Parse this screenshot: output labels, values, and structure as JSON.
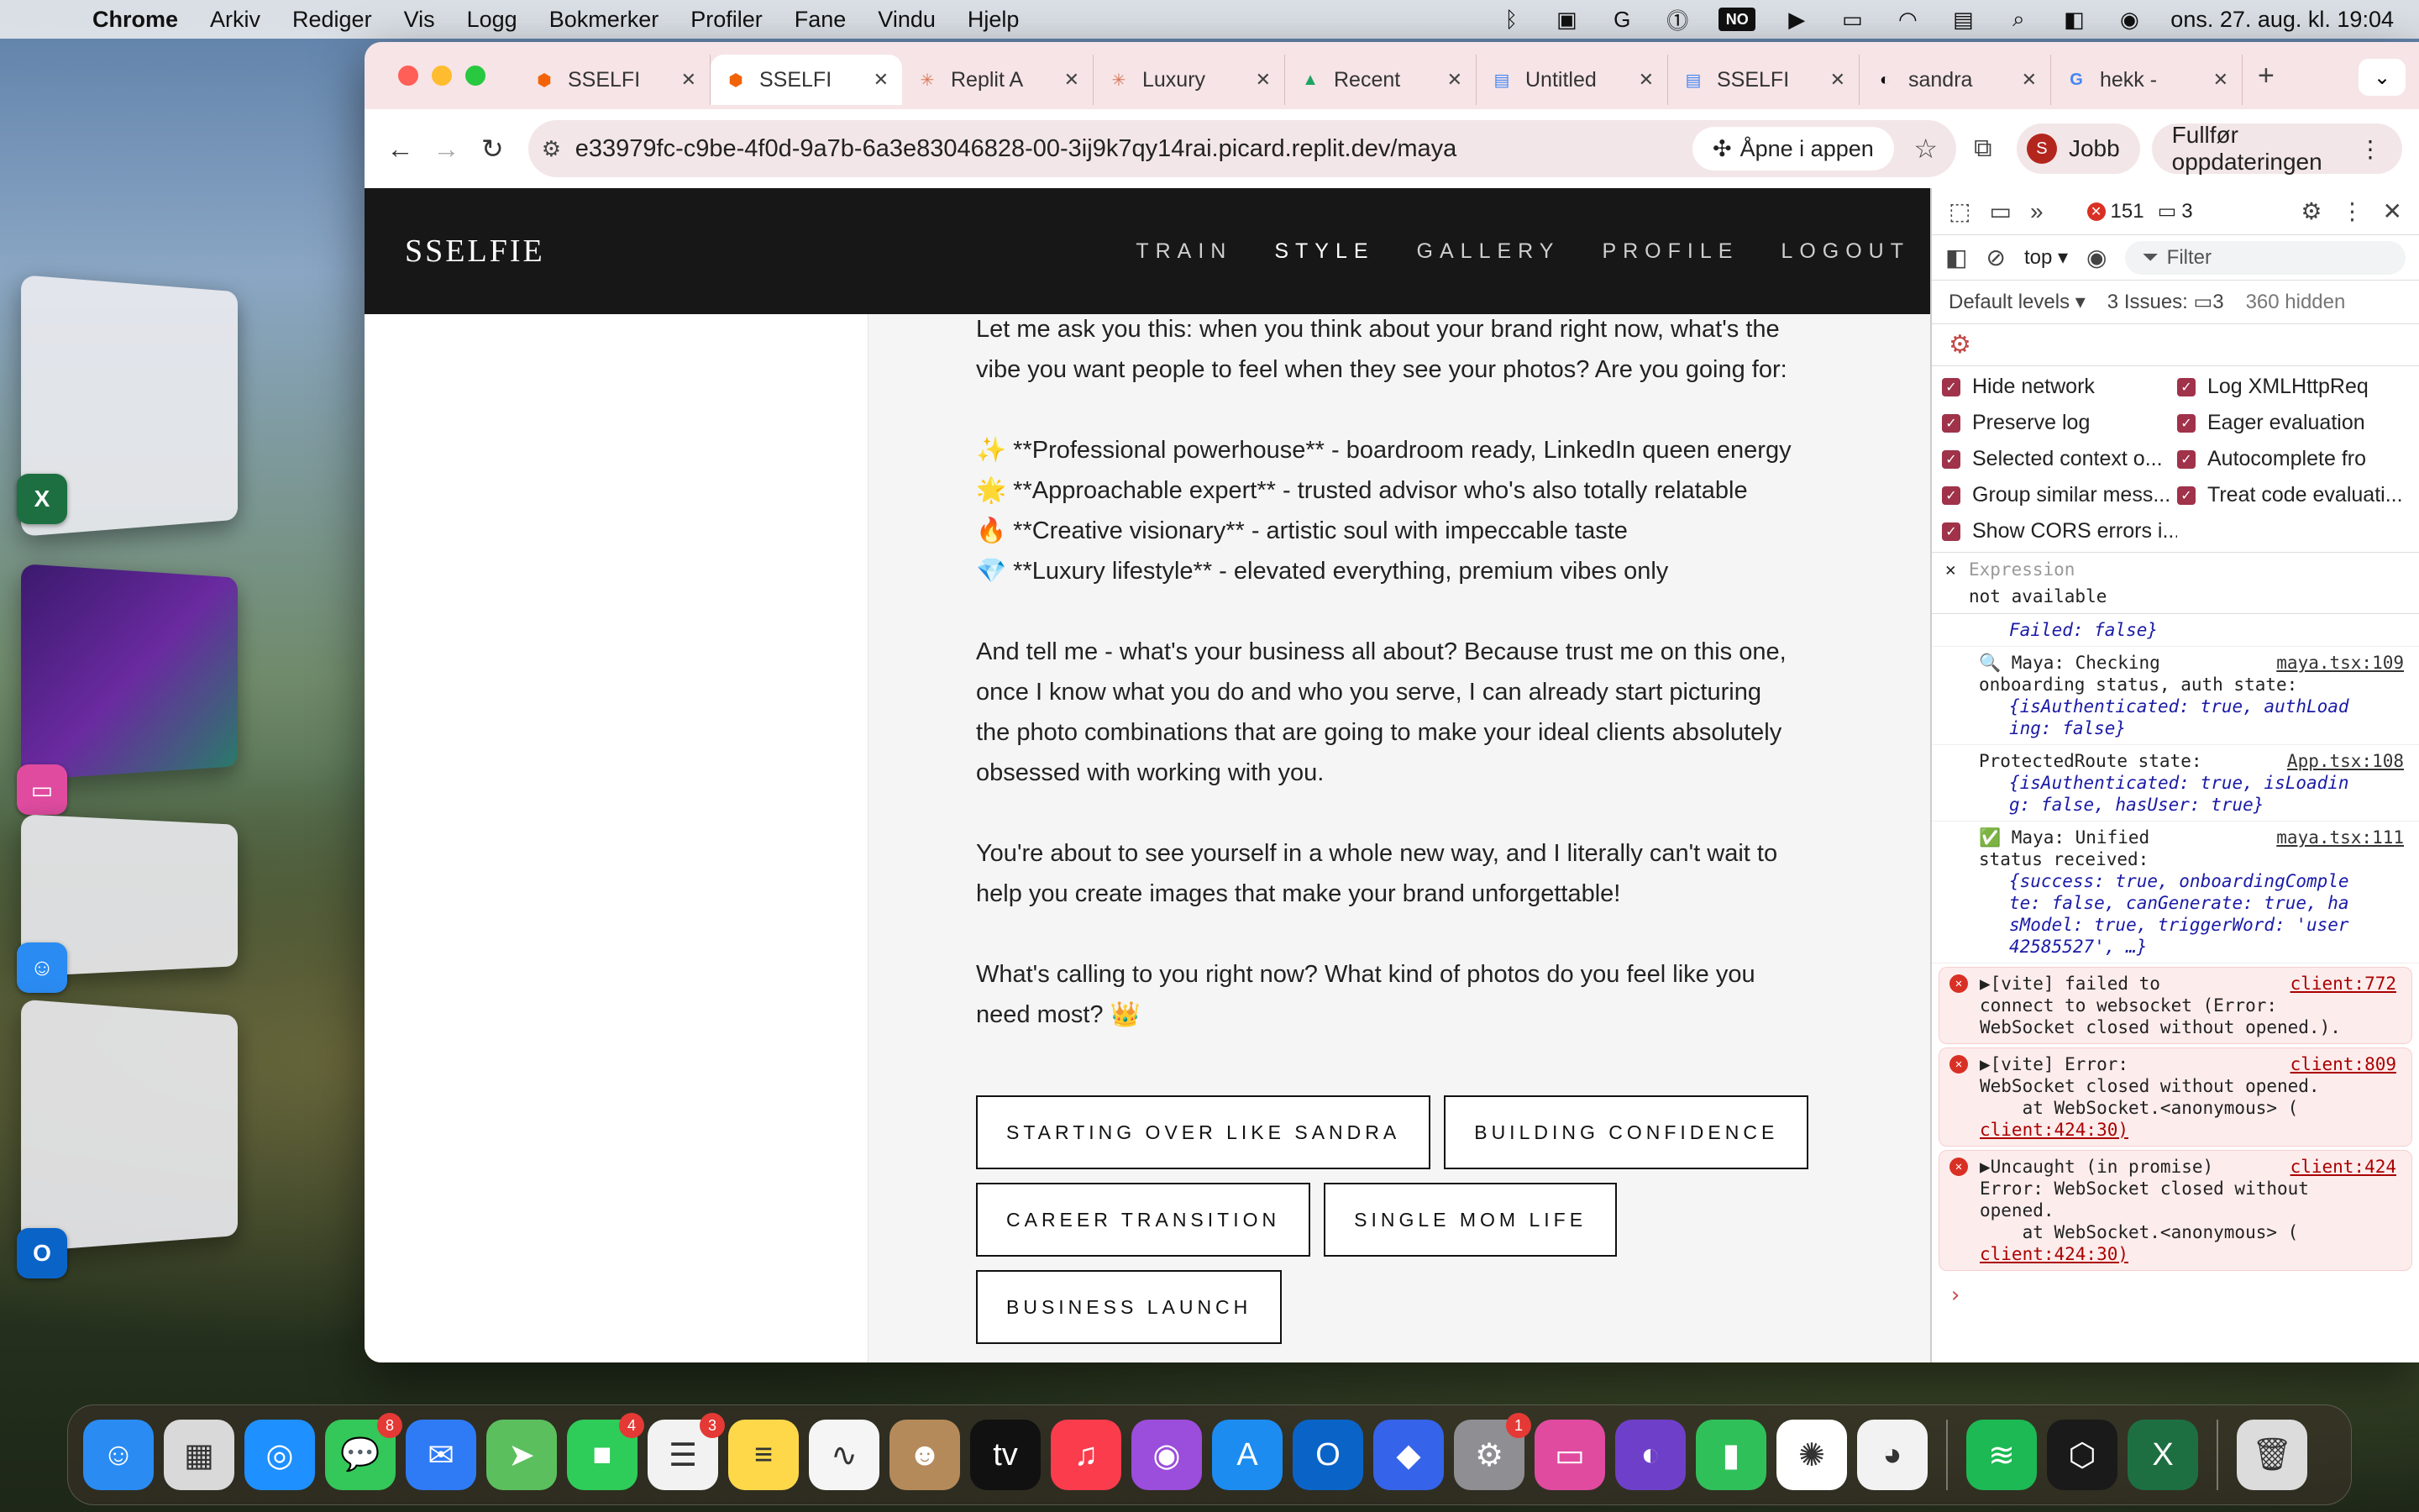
{
  "menubar": {
    "app": "Chrome",
    "items": [
      "Arkiv",
      "Rediger",
      "Vis",
      "Logg",
      "Bokmerker",
      "Profiler",
      "Fane",
      "Vindu",
      "Hjelp"
    ],
    "status_box": "NO",
    "datetime": "ons. 27. aug. kl. 19:04"
  },
  "tabs": [
    {
      "title": "SSELFI",
      "icon": "replit-icon",
      "active": false
    },
    {
      "title": "SSELFI",
      "icon": "replit-icon",
      "active": true
    },
    {
      "title": "Replit A",
      "icon": "claude-icon",
      "active": false
    },
    {
      "title": "Luxury",
      "icon": "claude-icon",
      "active": false
    },
    {
      "title": "Recent",
      "icon": "drive-icon",
      "active": false
    },
    {
      "title": "Untitled",
      "icon": "docs-icon",
      "active": false
    },
    {
      "title": "SSELFI",
      "icon": "docs-icon",
      "active": false
    },
    {
      "title": "sandra",
      "icon": "github-icon",
      "active": false
    },
    {
      "title": "hekk -",
      "icon": "google-icon",
      "active": false
    }
  ],
  "toolbar": {
    "url": "e33979fc-c9be-4f0d-9a7b-6a3e83046828-00-3ij9k7qy14rai.picard.replit.dev/maya",
    "open_in_app": "Åpne i appen",
    "profile_initial": "S",
    "profile_label": "Jobb",
    "update_label": "Fullfør oppdateringen"
  },
  "site": {
    "logo": "SSELFIE",
    "nav": [
      "TRAIN",
      "STYLE",
      "GALLERY",
      "PROFILE",
      "LOGOUT"
    ],
    "current_nav": "STYLE"
  },
  "chat": {
    "p1": [
      "Let me ask you this: when you think about your brand right now, what's the",
      "vibe you want people to feel when they see your photos? Are you going for:"
    ],
    "bullets": [
      "✨ **Professional powerhouse** - boardroom ready, LinkedIn queen energy",
      "🌟 **Approachable expert** - trusted advisor who's also totally relatable",
      "🔥 **Creative visionary** - artistic soul with impeccable taste",
      "💎 **Luxury lifestyle** - elevated everything, premium vibes only"
    ],
    "p2": [
      "And tell me - what's your business all about? Because trust me on this one,",
      "once I know what you do and who you serve, I can already start picturing",
      "the photo combinations that are going to make your ideal clients absolutely",
      "obsessed with working with you."
    ],
    "p3": [
      "You're about to see yourself in a whole new way, and I literally can't wait to",
      "help you create images that make your brand unforgettable!"
    ],
    "p4": [
      "What's calling to you right now? What kind of photos do you feel like you",
      "need most? 👑"
    ],
    "options": [
      "STARTING OVER LIKE SANDRA",
      "BUILDING CONFIDENCE",
      "CAREER TRANSITION",
      "SINGLE MOM LIFE",
      "BUSINESS LAUNCH"
    ]
  },
  "devtools": {
    "error_count": "151",
    "message_count": "3",
    "context": "top ▾",
    "filter_placeholder": "Filter",
    "levels": "Default levels ▾",
    "issues_label": "3 Issues:",
    "issues_count": "3",
    "hidden": "360 hidden",
    "settings_left": [
      "Hide network",
      "Preserve log",
      "Selected context o...",
      "Group similar mess...",
      "Show CORS errors i..."
    ],
    "settings_right": [
      "Log XMLHttpReq",
      "Eager evaluation",
      "Autocomplete fro",
      "Treat code evaluati..."
    ],
    "expression_label": "Expression",
    "expression_value": "not available",
    "logs": [
      {
        "type": "info",
        "lines": [
          "Failed: false}"
        ],
        "src": ""
      },
      {
        "type": "info",
        "lines": [
          "🔍 Maya: Checking",
          "onboarding status, auth state:"
        ],
        "obj": [
          "{isAuthenticated: true, authLoad",
          "ing: false}"
        ],
        "src": "maya.tsx:109"
      },
      {
        "type": "info",
        "lines": [
          "ProtectedRoute state:"
        ],
        "obj": [
          "{isAuthenticated: true, isLoadin",
          "g: false, hasUser: true}"
        ],
        "src": "App.tsx:108"
      },
      {
        "type": "info",
        "lines": [
          "✅ Maya: Unified",
          "status received:"
        ],
        "obj": [
          "{success: true, onboardingComple",
          "te: false, canGenerate: true, ha",
          "sModel: true, triggerWord: 'user",
          "42585527', …}"
        ],
        "src": "maya.tsx:111"
      },
      {
        "type": "error",
        "lines": [
          "▶[vite] failed to",
          "connect to websocket (Error:",
          "WebSocket closed without opened.)."
        ],
        "src": "client:772"
      },
      {
        "type": "error",
        "lines": [
          "▶[vite] Error:",
          "WebSocket closed without opened.",
          "    at WebSocket.<anonymous> (",
          "client:424:30)"
        ],
        "src": "client:809"
      },
      {
        "type": "error",
        "lines": [
          "▶Uncaught (in promise)",
          "Error: WebSocket closed without",
          "opened.",
          "    at WebSocket.<anonymous> (",
          "client:424:30)"
        ],
        "src": "client:424"
      }
    ]
  },
  "dock": {
    "apps": [
      {
        "name": "finder-icon",
        "color": "#2a8bf2",
        "glyph": "☺"
      },
      {
        "name": "launchpad-icon",
        "color": "#d9d9d9",
        "glyph": "▦"
      },
      {
        "name": "safari-icon",
        "color": "#1e90ff",
        "glyph": "◎"
      },
      {
        "name": "messages-icon",
        "color": "#34c759",
        "glyph": "💬",
        "badge": "8"
      },
      {
        "name": "mail-icon",
        "color": "#2f7bf6",
        "glyph": "✉"
      },
      {
        "name": "maps-icon",
        "color": "#5bbf5e",
        "glyph": "➤"
      },
      {
        "name": "facetime-icon",
        "color": "#2ecc59",
        "glyph": "■",
        "badge": "4"
      },
      {
        "name": "reminders-icon",
        "color": "#f2f2f2",
        "glyph": "☰",
        "badge": "3"
      },
      {
        "name": "notes-icon",
        "color": "#ffd84a",
        "glyph": "≡"
      },
      {
        "name": "freeform-icon",
        "color": "#f5f5f5",
        "glyph": "∿"
      },
      {
        "name": "contacts-icon",
        "color": "#b58a5a",
        "glyph": "☻"
      },
      {
        "name": "appletv-icon",
        "color": "#111111",
        "glyph": "tv"
      },
      {
        "name": "music-icon",
        "color": "#fa3c4c",
        "glyph": "♫"
      },
      {
        "name": "podcasts-icon",
        "color": "#9b4ddb",
        "glyph": "◉"
      },
      {
        "name": "appstore-icon",
        "color": "#1c8cf0",
        "glyph": "A"
      },
      {
        "name": "outlook-icon",
        "color": "#0a64c8",
        "glyph": "O"
      },
      {
        "name": "roblox-icon",
        "color": "#3563e9",
        "glyph": "◆"
      },
      {
        "name": "settings-icon",
        "color": "#8e8e93",
        "glyph": "⚙",
        "badge": "1"
      },
      {
        "name": "cleanmymac-icon",
        "color": "#e04ba0",
        "glyph": "▭"
      },
      {
        "name": "github-icon",
        "color": "#6e40c9",
        "glyph": "◐"
      },
      {
        "name": "numbers-icon",
        "color": "#30c05a",
        "glyph": "▮"
      },
      {
        "name": "chatgpt-icon",
        "color": "#ffffff",
        "glyph": "✺"
      },
      {
        "name": "chrome-icon",
        "color": "#f2f2f2",
        "glyph": "◕"
      },
      {
        "name": "spotify-icon",
        "color": "#1db954",
        "glyph": "≋"
      },
      {
        "name": "cube-icon",
        "color": "#1a1a1a",
        "glyph": "⬡"
      },
      {
        "name": "excel-icon",
        "color": "#1d6f42",
        "glyph": "X"
      },
      {
        "name": "trash-icon",
        "color": "#dcdcdc",
        "glyph": "🗑"
      }
    ]
  }
}
